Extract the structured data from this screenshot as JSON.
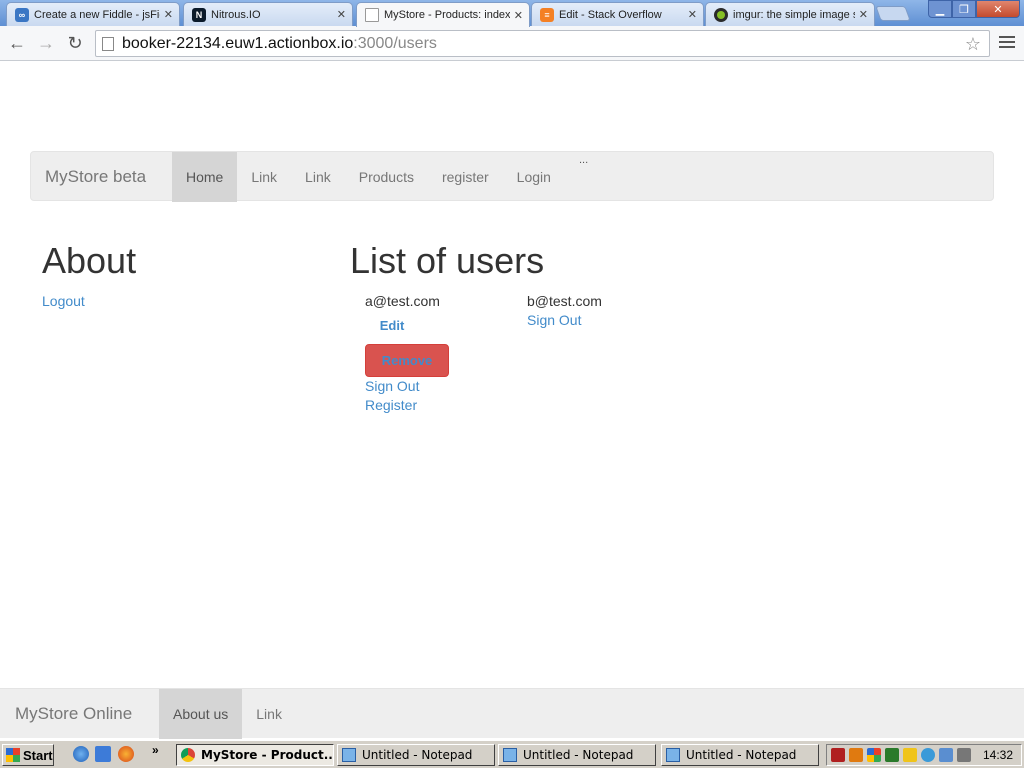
{
  "browser": {
    "tabs": [
      {
        "title": "Create a new Fiddle - jsFiddle",
        "icon": "jsfiddle-icon"
      },
      {
        "title": "Nitrous.IO",
        "icon": "nitrous-icon"
      },
      {
        "title": "MyStore - Products: index",
        "icon": "page-icon"
      },
      {
        "title": "Edit - Stack Overflow",
        "icon": "stackoverflow-icon"
      },
      {
        "title": "imgur: the simple image sharer",
        "icon": "imgur-icon"
      }
    ],
    "url_host": "booker-22134.euw1.actionbox.io",
    "url_path": ":3000/users"
  },
  "navbar": {
    "brand": "MyStore beta",
    "links": [
      "Home",
      "Link",
      "Link",
      "Products",
      "register",
      "Login"
    ],
    "active": "Home",
    "ellipsis": "..."
  },
  "about": {
    "title": "About",
    "logout": "Logout"
  },
  "users": {
    "title": "List of users",
    "user1": {
      "email": "a@test.com",
      "edit": "Edit",
      "remove": "Remove",
      "sign_out": "Sign Out",
      "register": "Register"
    },
    "user2": {
      "email": "b@test.com",
      "sign_out": "Sign Out"
    }
  },
  "footer": {
    "brand": "MyStore Online",
    "links": [
      "About us",
      "Link"
    ],
    "active": "About us"
  },
  "taskbar": {
    "start": "Start",
    "chevron": "»",
    "windows": [
      "MyStore - Product...",
      "Untitled - Notepad",
      "Untitled - Notepad",
      "Untitled - Notepad"
    ],
    "clock": "14:32"
  },
  "colors": {
    "link": "#428bca",
    "danger": "#d9534f",
    "navbar_bg": "#eeeeee"
  }
}
